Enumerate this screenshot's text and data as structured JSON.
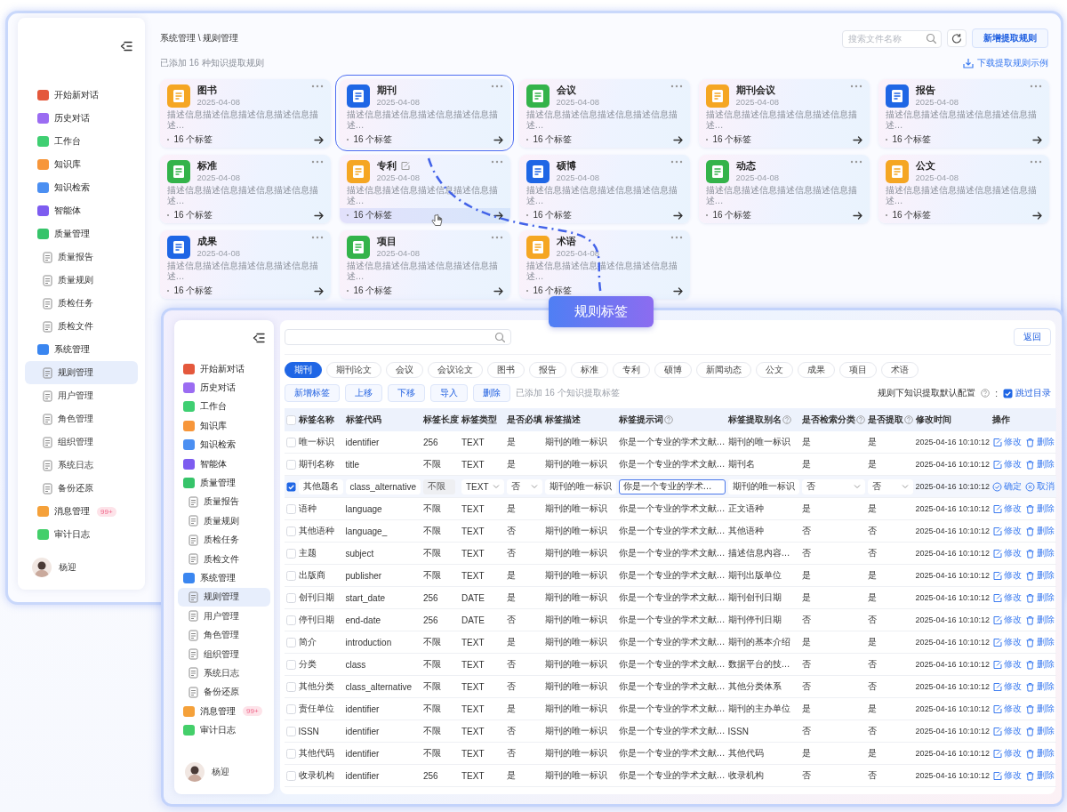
{
  "back_window": {
    "sidebar": {
      "items": [
        {
          "label": "开始新对话",
          "color": "#e4583c",
          "selected": false
        },
        {
          "label": "历史对话",
          "color": "#9b6cf2",
          "selected": false
        },
        {
          "label": "工作台",
          "color": "#3fcf72",
          "selected": false
        },
        {
          "label": "知识库",
          "color": "#f7963a",
          "selected": false
        },
        {
          "label": "知识检索",
          "color": "#4b8ff2",
          "selected": false
        },
        {
          "label": "智能体",
          "color": "#7d5cf0",
          "selected": false
        },
        {
          "label": "质量管理",
          "color": "#36c46a",
          "selected": false,
          "children": [
            {
              "label": "质量报告",
              "selected": false
            },
            {
              "label": "质量规则",
              "selected": false
            },
            {
              "label": "质检任务",
              "selected": false
            },
            {
              "label": "质检文件",
              "selected": false
            }
          ]
        },
        {
          "label": "系统管理",
          "color": "#3a86f0",
          "selected": false,
          "children": [
            {
              "label": "规则管理",
              "selected": true
            },
            {
              "label": "用户管理",
              "selected": false
            },
            {
              "label": "角色管理",
              "selected": false
            },
            {
              "label": "组织管理",
              "selected": false
            },
            {
              "label": "系统日志",
              "selected": false
            },
            {
              "label": "备份还原",
              "selected": false
            }
          ]
        },
        {
          "label": "消息管理",
          "color": "#f5a13a",
          "selected": false,
          "badge": "99+"
        },
        {
          "label": "审计日志",
          "color": "#44cf6a",
          "selected": false
        }
      ],
      "user": {
        "name": "杨迎"
      }
    },
    "breadcrumb": "系统管理 \\ 规则管理",
    "search": {
      "placeholder": "搜索文件名称"
    },
    "add_button": "新增提取规则",
    "summary": "已添加 16 种知识提取规则",
    "download_link": "下载提取规则示例",
    "cards": [
      {
        "title": "图书",
        "date": "2025-04-08",
        "description": "描述信息描述信息描述信息描述信息描述…",
        "tag_count": "16 个标签",
        "color": "#f5a623",
        "selected": false,
        "hovered": false
      },
      {
        "title": "期刊",
        "date": "2025-04-08",
        "description": "描述信息描述信息描述信息描述信息描述…",
        "tag_count": "16 个标签",
        "color": "#1f66e5",
        "selected": true,
        "hovered": false
      },
      {
        "title": "会议",
        "date": "2025-04-08",
        "description": "描述信息描述信息描述信息描述信息描述…",
        "tag_count": "16 个标签",
        "color": "#34b34a",
        "selected": false,
        "hovered": false
      },
      {
        "title": "期刊会议",
        "date": "2025-04-08",
        "description": "描述信息描述信息描述信息描述信息描述…",
        "tag_count": "16 个标签",
        "color": "#f5a623",
        "selected": false,
        "hovered": false
      },
      {
        "title": "报告",
        "date": "2025-04-08",
        "description": "描述信息描述信息描述信息描述信息描述…",
        "tag_count": "16 个标签",
        "color": "#1f66e5",
        "selected": false,
        "hovered": false
      },
      {
        "title": "标准",
        "date": "2025-04-08",
        "description": "描述信息描述信息描述信息描述信息描述…",
        "tag_count": "16 个标签",
        "color": "#34b34a",
        "selected": false,
        "hovered": false
      },
      {
        "title": "专利",
        "date": "2025-04-08",
        "description": "描述信息描述信息描述信息描述信息描述…",
        "tag_count": "16 个标签",
        "color": "#f5a623",
        "selected": false,
        "hovered": true
      },
      {
        "title": "硕博",
        "date": "2025-04-08",
        "description": "描述信息描述信息描述信息描述信息描述…",
        "tag_count": "16 个标签",
        "color": "#1f66e5",
        "selected": false,
        "hovered": false
      },
      {
        "title": "动态",
        "date": "2025-04-08",
        "description": "描述信息描述信息描述信息描述信息描述…",
        "tag_count": "16 个标签",
        "color": "#34b34a",
        "selected": false,
        "hovered": false
      },
      {
        "title": "公文",
        "date": "2025-04-08",
        "description": "描述信息描述信息描述信息描述信息描述…",
        "tag_count": "16 个标签",
        "color": "#f5a623",
        "selected": false,
        "hovered": false
      },
      {
        "title": "成果",
        "date": "2025-04-08",
        "description": "描述信息描述信息描述信息描述信息描述…",
        "tag_count": "16 个标签",
        "color": "#1f66e5",
        "selected": false,
        "hovered": false
      },
      {
        "title": "项目",
        "date": "2025-04-08",
        "description": "描述信息描述信息描述信息描述信息描述…",
        "tag_count": "16 个标签",
        "color": "#34b34a",
        "selected": false,
        "hovered": false
      },
      {
        "title": "术语",
        "date": "2025-04-08",
        "description": "描述信息描述信息描述信息描述信息描述…",
        "tag_count": "16 个标签",
        "color": "#f5a623",
        "selected": false,
        "hovered": false
      }
    ]
  },
  "callout": "规则标签",
  "front_window": {
    "sidebar": {
      "items": [
        {
          "label": "开始新对话",
          "color": "#e4583c",
          "selected": false
        },
        {
          "label": "历史对话",
          "color": "#9b6cf2",
          "selected": false
        },
        {
          "label": "工作台",
          "color": "#3fcf72",
          "selected": false
        },
        {
          "label": "知识库",
          "color": "#f7963a",
          "selected": false
        },
        {
          "label": "知识检索",
          "color": "#4b8ff2",
          "selected": false
        },
        {
          "label": "智能体",
          "color": "#7d5cf0",
          "selected": false
        },
        {
          "label": "质量管理",
          "color": "#36c46a",
          "selected": false,
          "children": [
            {
              "label": "质量报告",
              "selected": false
            },
            {
              "label": "质量规则",
              "selected": false
            },
            {
              "label": "质检任务",
              "selected": false
            },
            {
              "label": "质检文件",
              "selected": false
            }
          ]
        },
        {
          "label": "系统管理",
          "color": "#3a86f0",
          "selected": false,
          "children": [
            {
              "label": "规则管理",
              "selected": true
            },
            {
              "label": "用户管理",
              "selected": false
            },
            {
              "label": "角色管理",
              "selected": false
            },
            {
              "label": "组织管理",
              "selected": false
            },
            {
              "label": "系统日志",
              "selected": false
            },
            {
              "label": "备份还原",
              "selected": false
            }
          ]
        },
        {
          "label": "消息管理",
          "color": "#f5a13a",
          "selected": false,
          "badge": "99+"
        },
        {
          "label": "审计日志",
          "color": "#44cf6a",
          "selected": false
        }
      ],
      "user": {
        "name": "杨迎"
      }
    },
    "return_button": "返回",
    "tabs": [
      {
        "label": "期刊",
        "selected": true
      },
      {
        "label": "期刊论文",
        "selected": false
      },
      {
        "label": "会议",
        "selected": false
      },
      {
        "label": "会议论文",
        "selected": false
      },
      {
        "label": "图书",
        "selected": false
      },
      {
        "label": "报告",
        "selected": false
      },
      {
        "label": "标准",
        "selected": false
      },
      {
        "label": "专利",
        "selected": false
      },
      {
        "label": "硕博",
        "selected": false
      },
      {
        "label": "新闻动态",
        "selected": false
      },
      {
        "label": "公文",
        "selected": false
      },
      {
        "label": "成果",
        "selected": false
      },
      {
        "label": "项目",
        "selected": false
      },
      {
        "label": "术语",
        "selected": false
      }
    ],
    "toolbar_buttons": [
      "新增标签",
      "上移",
      "下移",
      "导入",
      "删除"
    ],
    "summary": "已添加 16 个知识提取标签",
    "default_config": {
      "label": "规则下知识提取默认配置",
      "separator": ":",
      "option": {
        "label": "跳过目录",
        "checked": true
      }
    },
    "table": {
      "all_selected": false,
      "columns": [
        {
          "label": "标签名称",
          "help": false
        },
        {
          "label": "标签代码",
          "help": false
        },
        {
          "label": "标签长度",
          "help": false
        },
        {
          "label": "标签类型",
          "help": false
        },
        {
          "label": "是否必填",
          "help": false
        },
        {
          "label": "标签描述",
          "help": false
        },
        {
          "label": "标签提示词",
          "help": true
        },
        {
          "label": "标签提取别名",
          "help": true
        },
        {
          "label": "是否检索分类",
          "help": true
        },
        {
          "label": "是否提取",
          "help": true
        },
        {
          "label": "修改时间",
          "help": false
        },
        {
          "label": "操作",
          "help": false
        }
      ],
      "rows": [
        {
          "selected": false,
          "editing": false,
          "cells": [
            "唯一标识",
            "identifier",
            "256",
            "TEXT",
            "是",
            "期刊的唯一标识",
            "你是一个专业的学术文献…",
            "期刊的唯一标识",
            "是",
            "是",
            "2025-04-16 10:10:12"
          ],
          "actions": [
            {
              "kind": "edit",
              "label": "修改"
            },
            {
              "kind": "delete",
              "label": "删除"
            }
          ]
        },
        {
          "selected": false,
          "editing": false,
          "cells": [
            "期刊名称",
            "title",
            "不限",
            "TEXT",
            "是",
            "期刊的唯一标识",
            "你是一个专业的学术文献…",
            "期刊名",
            "是",
            "是",
            "2025-04-16 10:10:12"
          ],
          "actions": [
            {
              "kind": "edit",
              "label": "修改"
            },
            {
              "kind": "delete",
              "label": "删除"
            }
          ]
        },
        {
          "selected": true,
          "editing": true,
          "cells": [
            {
              "kind": "input",
              "value": "其他题名",
              "focused": false
            },
            {
              "kind": "input",
              "value": "class_alternative",
              "focused": false
            },
            {
              "kind": "disabled",
              "value": "不限"
            },
            {
              "kind": "select",
              "value": "TEXT"
            },
            {
              "kind": "select",
              "value": "否"
            },
            {
              "kind": "input",
              "value": "期刊的唯一标识",
              "focused": false
            },
            {
              "kind": "input",
              "value": "你是一个专业的学术…",
              "focused": true
            },
            {
              "kind": "input",
              "value": "期刊的唯一标识",
              "focused": false
            },
            {
              "kind": "select",
              "value": "否"
            },
            {
              "kind": "select",
              "value": "否"
            },
            "2025-04-16 10:10:12"
          ],
          "actions": [
            {
              "kind": "confirm",
              "label": "确定"
            },
            {
              "kind": "cancel",
              "label": "取消"
            }
          ]
        },
        {
          "selected": false,
          "editing": false,
          "cells": [
            "语种",
            "language",
            "不限",
            "TEXT",
            "是",
            "期刊的唯一标识",
            "你是一个专业的学术文献…",
            "正文语种",
            "是",
            "是",
            "2025-04-16 10:10:12"
          ],
          "actions": [
            {
              "kind": "edit",
              "label": "修改"
            },
            {
              "kind": "delete",
              "label": "删除"
            }
          ]
        },
        {
          "selected": false,
          "editing": false,
          "cells": [
            "其他语种",
            "language_",
            "不限",
            "TEXT",
            "否",
            "期刊的唯一标识",
            "你是一个专业的学术文献…",
            "其他语种",
            "否",
            "否",
            "2025-04-16 10:10:12"
          ],
          "actions": [
            {
              "kind": "edit",
              "label": "修改"
            },
            {
              "kind": "delete",
              "label": "删除"
            }
          ]
        },
        {
          "selected": false,
          "editing": false,
          "cells": [
            "主题",
            "subject",
            "不限",
            "TEXT",
            "否",
            "期刊的唯一标识",
            "你是一个专业的学术文献…",
            "描述信息内容…",
            "否",
            "否",
            "2025-04-16 10:10:12"
          ],
          "actions": [
            {
              "kind": "edit",
              "label": "修改"
            },
            {
              "kind": "delete",
              "label": "删除"
            }
          ]
        },
        {
          "selected": false,
          "editing": false,
          "cells": [
            "出版商",
            "publisher",
            "不限",
            "TEXT",
            "是",
            "期刊的唯一标识",
            "你是一个专业的学术文献…",
            "期刊出版单位",
            "是",
            "是",
            "2025-04-16 10:10:12"
          ],
          "actions": [
            {
              "kind": "edit",
              "label": "修改"
            },
            {
              "kind": "delete",
              "label": "删除"
            }
          ]
        },
        {
          "selected": false,
          "editing": false,
          "cells": [
            "创刊日期",
            "start_date",
            "256",
            "DATE",
            "是",
            "期刊的唯一标识",
            "你是一个专业的学术文献…",
            "期刊创刊日期",
            "是",
            "是",
            "2025-04-16 10:10:12"
          ],
          "actions": [
            {
              "kind": "edit",
              "label": "修改"
            },
            {
              "kind": "delete",
              "label": "删除"
            }
          ]
        },
        {
          "selected": false,
          "editing": false,
          "cells": [
            "停刊日期",
            "end-date",
            "256",
            "DATE",
            "否",
            "期刊的唯一标识",
            "你是一个专业的学术文献…",
            "期刊停刊日期",
            "否",
            "否",
            "2025-04-16 10:10:12"
          ],
          "actions": [
            {
              "kind": "edit",
              "label": "修改"
            },
            {
              "kind": "delete",
              "label": "删除"
            }
          ]
        },
        {
          "selected": false,
          "editing": false,
          "cells": [
            "简介",
            "introduction",
            "不限",
            "TEXT",
            "是",
            "期刊的唯一标识",
            "你是一个专业的学术文献…",
            "期刊的基本介绍",
            "是",
            "是",
            "2025-04-16 10:10:12"
          ],
          "actions": [
            {
              "kind": "edit",
              "label": "修改"
            },
            {
              "kind": "delete",
              "label": "删除"
            }
          ]
        },
        {
          "selected": false,
          "editing": false,
          "cells": [
            "分类",
            "class",
            "不限",
            "TEXT",
            "否",
            "期刊的唯一标识",
            "你是一个专业的学术文献…",
            "数据平台的技…",
            "否",
            "否",
            "2025-04-16 10:10:12"
          ],
          "actions": [
            {
              "kind": "edit",
              "label": "修改"
            },
            {
              "kind": "delete",
              "label": "删除"
            }
          ]
        },
        {
          "selected": false,
          "editing": false,
          "cells": [
            "其他分类",
            "class_alternative",
            "不限",
            "TEXT",
            "否",
            "期刊的唯一标识",
            "你是一个专业的学术文献…",
            "其他分类体系",
            "否",
            "否",
            "2025-04-16 10:10:12"
          ],
          "actions": [
            {
              "kind": "edit",
              "label": "修改"
            },
            {
              "kind": "delete",
              "label": "删除"
            }
          ]
        },
        {
          "selected": false,
          "editing": false,
          "cells": [
            "责任单位",
            "identifier",
            "不限",
            "TEXT",
            "是",
            "期刊的唯一标识",
            "你是一个专业的学术文献…",
            "期刊的主办单位",
            "是",
            "是",
            "2025-04-16 10:10:12"
          ],
          "actions": [
            {
              "kind": "edit",
              "label": "修改"
            },
            {
              "kind": "delete",
              "label": "删除"
            }
          ]
        },
        {
          "selected": false,
          "editing": false,
          "cells": [
            "ISSN",
            "identifier",
            "不限",
            "TEXT",
            "否",
            "期刊的唯一标识",
            "你是一个专业的学术文献…",
            "ISSN",
            "否",
            "否",
            "2025-04-16 10:10:12"
          ],
          "actions": [
            {
              "kind": "edit",
              "label": "修改"
            },
            {
              "kind": "delete",
              "label": "删除"
            }
          ]
        },
        {
          "selected": false,
          "editing": false,
          "cells": [
            "其他代码",
            "identifier",
            "不限",
            "TEXT",
            "否",
            "期刊的唯一标识",
            "你是一个专业的学术文献…",
            "其他代码",
            "是",
            "是",
            "2025-04-16 10:10:12"
          ],
          "actions": [
            {
              "kind": "edit",
              "label": "修改"
            },
            {
              "kind": "delete",
              "label": "删除"
            }
          ]
        },
        {
          "selected": false,
          "editing": false,
          "cells": [
            "收录机构",
            "identifier",
            "256",
            "TEXT",
            "是",
            "期刊的唯一标识",
            "你是一个专业的学术文献…",
            "收录机构",
            "否",
            "否",
            "2025-04-16 10:10:12"
          ],
          "actions": [
            {
              "kind": "edit",
              "label": "修改"
            },
            {
              "kind": "delete",
              "label": "删除"
            }
          ]
        }
      ]
    }
  }
}
